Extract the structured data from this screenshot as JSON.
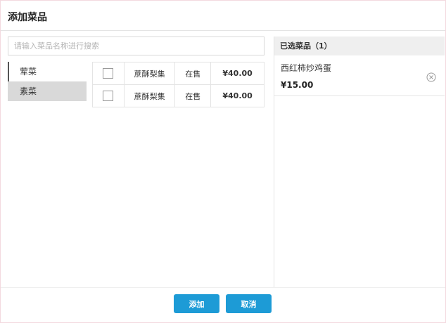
{
  "dialog": {
    "title": "添加菜品"
  },
  "search": {
    "placeholder": "请输入菜品名称进行搜索",
    "value": ""
  },
  "categories": [
    {
      "label": "荤菜",
      "active": false
    },
    {
      "label": "素菜",
      "active": true
    }
  ],
  "dishes": [
    {
      "checked": false,
      "name": "蔗酥梨集",
      "status": "在售",
      "price": "¥40.00"
    },
    {
      "checked": false,
      "name": "蔗酥梨集",
      "status": "在售",
      "price": "¥40.00"
    }
  ],
  "selected": {
    "header": "已选菜品（1）",
    "items": [
      {
        "name": "西红柿炒鸡蛋",
        "price": "¥15.00",
        "remove_icon": "circle-close-icon"
      }
    ]
  },
  "footer": {
    "add_label": "添加",
    "cancel_label": "取消"
  },
  "colors": {
    "primary": "#1d9bd6",
    "active_category_bg": "#d9d9d9",
    "panel_header_bg": "#efefef"
  }
}
